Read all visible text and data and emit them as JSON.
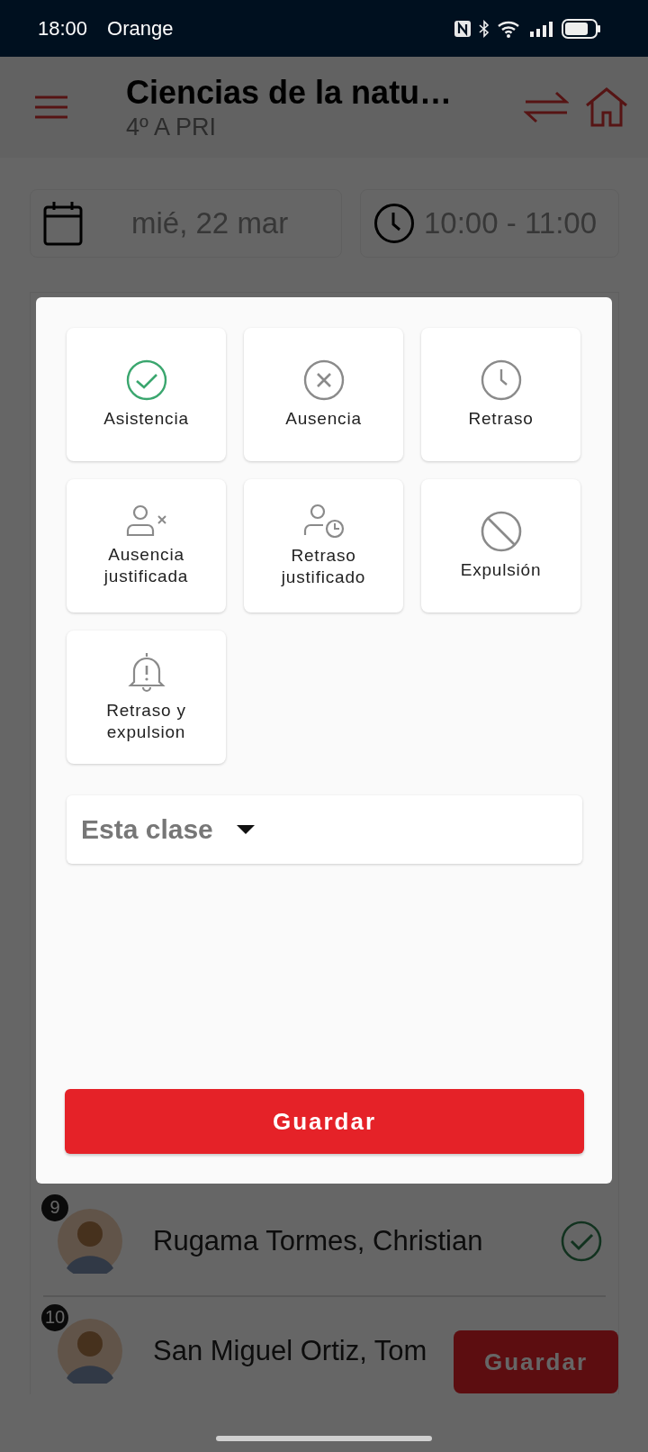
{
  "status_bar": {
    "time": "18:00",
    "carrier": "Orange"
  },
  "app_bar": {
    "title": "Ciencias de la natu…",
    "subtitle": "4º A PRI"
  },
  "date_field": {
    "value": "mié, 22 mar"
  },
  "time_field": {
    "value": "10:00 - 11:00"
  },
  "students": [
    {
      "number": "9",
      "name": "Rugama Tormes, Christian",
      "present": true
    },
    {
      "number": "10",
      "name": "San Miguel Ortiz, Tom"
    }
  ],
  "floating_save_button": {
    "label": "Guardar"
  },
  "dialog": {
    "options": [
      {
        "kind": "check",
        "label": "Asistencia",
        "selected": true
      },
      {
        "kind": "cross",
        "label": "Ausencia",
        "selected": false
      },
      {
        "kind": "clock",
        "label": "Retraso",
        "selected": false
      },
      {
        "kind": "person-cross",
        "label": "Ausencia justificada",
        "selected": false
      },
      {
        "kind": "person-clock",
        "label": "Retraso justificado",
        "selected": false
      },
      {
        "kind": "ban",
        "label": "Expulsión",
        "selected": false
      },
      {
        "kind": "bell",
        "label": "Retraso y expulsion",
        "selected": false
      }
    ],
    "scope_dropdown": {
      "value": "Esta clase"
    },
    "save_button": {
      "label": "Guardar"
    }
  }
}
